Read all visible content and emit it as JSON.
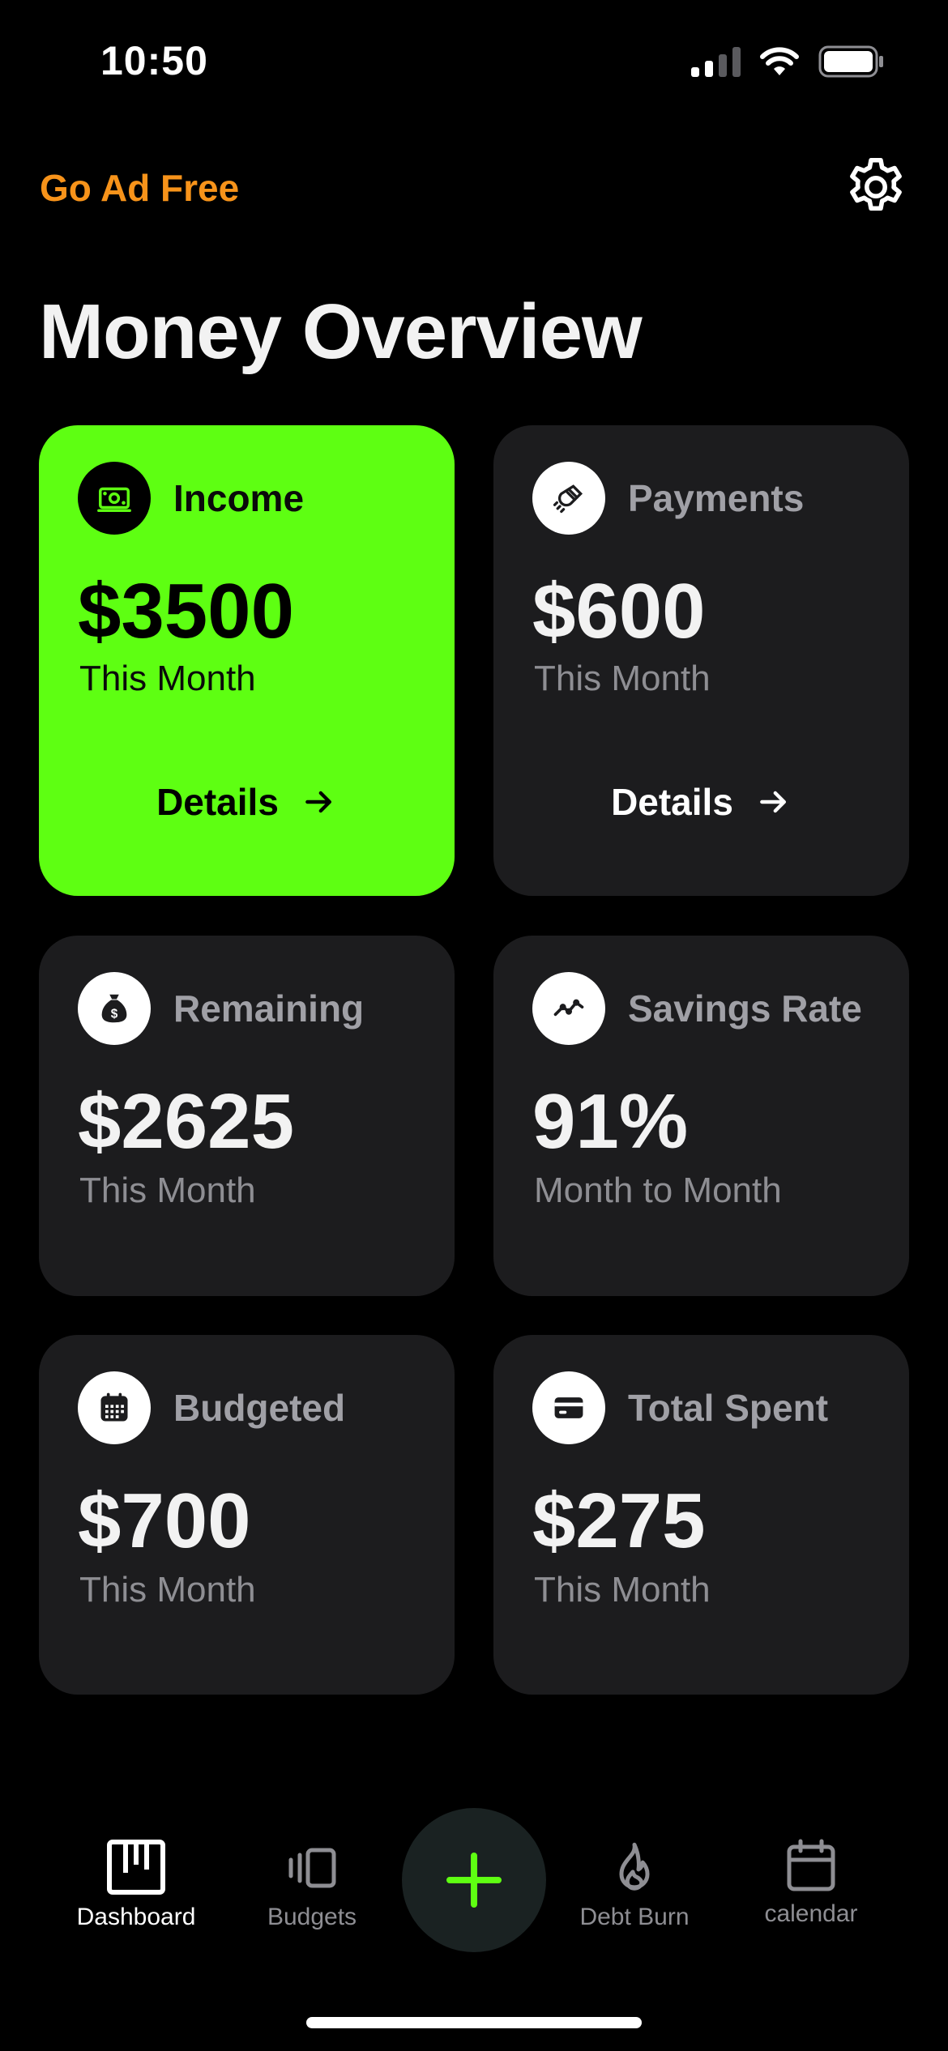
{
  "status_bar": {
    "time": "10:50",
    "icons": [
      "cellular-signal-icon",
      "wifi-icon",
      "battery-icon"
    ]
  },
  "header": {
    "ad_free_label": "Go Ad Free",
    "settings_icon": "gear-icon",
    "title": "Money Overview"
  },
  "colors": {
    "background": "#000000",
    "card": "#1c1c1e",
    "accent_green": "#5eff12",
    "ad_free_orange": "#f7931a",
    "muted_text": "#8e8e93"
  },
  "cards": [
    {
      "id": "income",
      "icon": "cash-icon",
      "label": "Income",
      "value": "$3500",
      "subtitle": "This Month",
      "details_label": "Details",
      "highlighted": true
    },
    {
      "id": "payments",
      "icon": "magnet-icon",
      "label": "Payments",
      "value": "$600",
      "subtitle": "This Month",
      "details_label": "Details",
      "highlighted": false
    },
    {
      "id": "remaining",
      "icon": "money-bag-icon",
      "label": "Remaining",
      "value": "$2625",
      "subtitle": "This Month"
    },
    {
      "id": "savings-rate",
      "icon": "trend-line-icon",
      "label": "Savings Rate",
      "value": "91%",
      "subtitle": "Month to Month"
    },
    {
      "id": "budgeted",
      "icon": "calendar-grid-icon",
      "label": "Budgeted",
      "value": "$700",
      "subtitle": "This Month"
    },
    {
      "id": "total-spent",
      "icon": "credit-card-icon",
      "label": "Total Spent",
      "value": "$275",
      "subtitle": "This Month"
    }
  ],
  "tab_bar": {
    "tabs": [
      {
        "label": "Dashboard",
        "icon": "dashboard-icon",
        "active": true
      },
      {
        "label": "Budgets",
        "icon": "budgets-icon",
        "active": false
      },
      {
        "label": "Debt Burn",
        "icon": "flame-icon",
        "active": false
      },
      {
        "label": "calendar",
        "icon": "calendar-icon",
        "active": false
      }
    ],
    "add_button_icon": "plus-icon"
  }
}
